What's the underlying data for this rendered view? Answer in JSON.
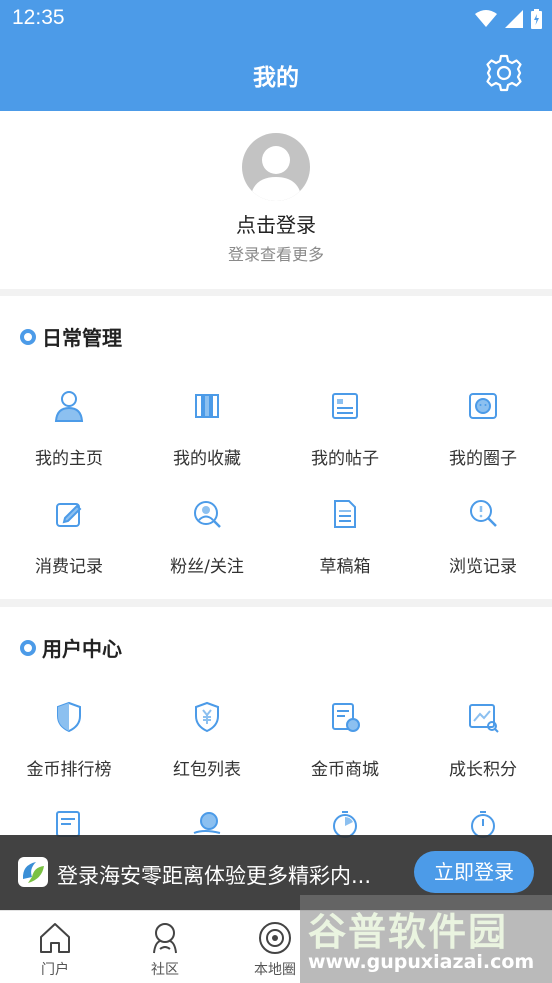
{
  "status_bar": {
    "time": "12:35"
  },
  "header": {
    "title": "我的"
  },
  "profile": {
    "login_title": "点击登录",
    "login_subtitle": "登录查看更多"
  },
  "daily": {
    "title": "日常管理",
    "items": [
      {
        "label": "我的主页",
        "icon": "user-icon"
      },
      {
        "label": "我的收藏",
        "icon": "bookshelf-icon"
      },
      {
        "label": "我的帖子",
        "icon": "post-icon"
      },
      {
        "label": "我的圈子",
        "icon": "circle-face-icon"
      },
      {
        "label": "消费记录",
        "icon": "edit-icon"
      },
      {
        "label": "粉丝/关注",
        "icon": "fans-icon"
      },
      {
        "label": "草稿箱",
        "icon": "draft-icon"
      },
      {
        "label": "浏览记录",
        "icon": "browse-icon"
      }
    ]
  },
  "user_center": {
    "title": "用户中心",
    "items": [
      {
        "label": "金币排行榜",
        "icon": "shield-icon"
      },
      {
        "label": "红包列表",
        "icon": "red-packet-icon"
      },
      {
        "label": "金币商城",
        "icon": "mall-icon"
      },
      {
        "label": "成长积分",
        "icon": "growth-icon"
      }
    ]
  },
  "banner": {
    "text": "登录海安零距离体验更多精彩内...",
    "button": "立即登录"
  },
  "tabs": [
    {
      "label": "门户",
      "icon": "home-icon"
    },
    {
      "label": "社区",
      "icon": "community-icon"
    },
    {
      "label": "本地圈",
      "icon": "local-circle-icon"
    }
  ],
  "watermark": {
    "main": "谷普软件园",
    "sub": "www.gupuxiazai.com"
  },
  "colors": {
    "accent": "#4c9be8",
    "banner_bg": "#2d2d2d"
  }
}
